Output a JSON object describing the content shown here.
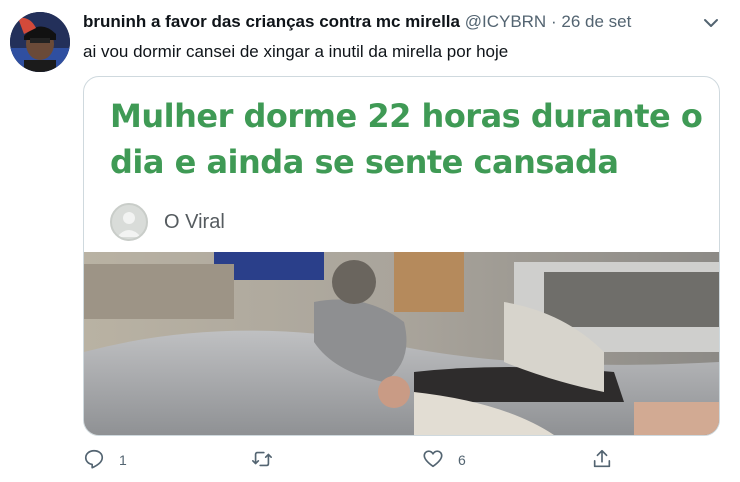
{
  "tweet": {
    "display_name": "bruninh a favor das crianças contra mc mirella",
    "handle": "@ICYBRN",
    "separator": "·",
    "date": "26 de set",
    "text": "ai vou dormir cansei de xingar a inutil da mirella por hoje",
    "icons": [
      "avatar",
      "chevron-down-icon"
    ]
  },
  "card": {
    "headline": "Mulher dorme 22 horas durante o dia e ainda se sente cansada",
    "source_name": "O Viral",
    "headline_color": "#3f9a55"
  },
  "actions": {
    "reply_count": "1",
    "retweet_count": "",
    "like_count": "6",
    "icons": [
      "reply-icon",
      "retweet-icon",
      "like-icon",
      "share-icon"
    ]
  }
}
